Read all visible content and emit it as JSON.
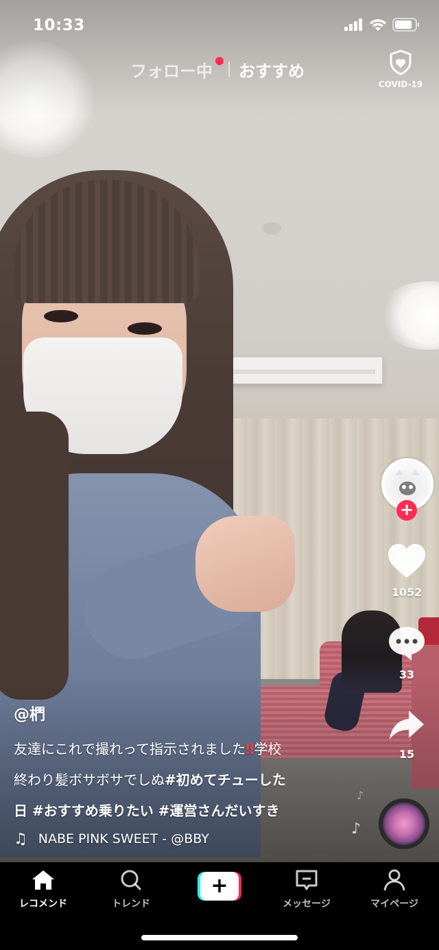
{
  "status_bar": {
    "time": "10:33"
  },
  "top_tabs": {
    "following": "フォロー中",
    "for_you": "おすすめ",
    "covid_label": "COVID-19"
  },
  "right_rail": {
    "likes": "1052",
    "comments": "33",
    "shares": "15"
  },
  "post": {
    "username": "@椚",
    "caption_line1": "友達にこれで撮れって指示されました",
    "caption_line1_end": "学校",
    "caption_line2_plain": "終わり髪ボサボサでしぬ",
    "caption_line2_tag": "#初めてチューした",
    "caption_line3": "日 #おすすめ乗りたい #運営さんだいすき",
    "sound": "NABE    PINK SWEET - @BBY"
  },
  "bottom_nav": {
    "home": "レコメンド",
    "discover": "トレンド",
    "create": "+",
    "inbox": "メッセージ",
    "profile": "マイページ"
  },
  "colors": {
    "accent": "#fe2c55",
    "cyan": "#25f4ee",
    "nav_bg": "#000000"
  },
  "icons": [
    "signal-icon",
    "wifi-icon",
    "battery-icon",
    "shield-icon",
    "heart-icon",
    "comment-icon",
    "share-icon",
    "music-note-icon",
    "home-icon",
    "search-icon",
    "inbox-icon",
    "profile-icon"
  ]
}
